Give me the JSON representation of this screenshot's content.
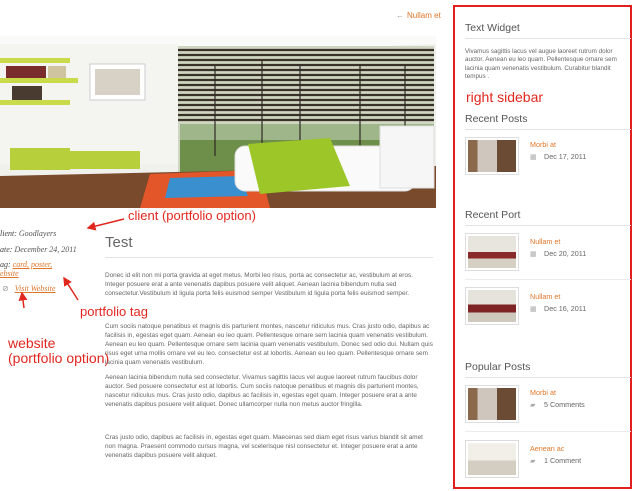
{
  "nav": {
    "next_label": "Nullam et",
    "arrow": "←"
  },
  "meta": {
    "client_label": "lient:",
    "client_value": "Goodlayers",
    "date_label": "ate:",
    "date_value": "December 24, 2011",
    "tag_label": "ag:",
    "tag_values": "card, poster,",
    "tag_cont": "ebsite",
    "website_link": "Visit Website"
  },
  "annotations": {
    "client": "client (portfolio option)",
    "tag": "portfolio tag",
    "website_line1": "website",
    "website_line2": "(portfolio option)",
    "sidebar": "right sidebar"
  },
  "article": {
    "title": "Test",
    "paragraphs": [
      "Donec id elit non mi porta gravida at eget metus. Morbi leo risus, porta ac consectetur ac, vestibulum at eros. Integer posuere erat a ante venenatis dapibus posuere velit aliquet. Aenean lacinia bibendum nulla sed consectetur.Vestibulum id ligula porta felis euismod semper Vestibulum id ligula porta felis euismod semper.",
      "Cum sociis natoque penatibus et magnis dis parturient montes, nascetur ridiculus mus. Cras justo odio, dapibus ac facilisis in, egestas eget quam. Aenean eu leo quam. Pellentesque ornare sem lacinia quam venenatis vestibulum. Aenean eu leo quam. Pellentesque ornare sem lacinia quam venenatis vestibulum. Donec sed odio dui. Nullam quis risus eget urna mollis ornare vel eu leo. consectetur est at lobortis. Aenean eu leo quam. Pellentesque ornare sem lacinia quam venenatis vestibulum.",
      "Aenean lacinia bibendum nulla sed consectetur. Vivamus sagittis lacus vel augue laoreet rutrum faucibus dolor auctor. Sed posuere consectetur est at lobortis. Cum sociis natoque penatibus et magnis dis parturient montes, nascetur ridiculus mus. Cras justo odio, dapibus ac facilisis in, egestas eget quam. Integer posuere erat a ante venenatis dapibus posuere velit aliquet. Donec ullamcorper nulla non metus auctor fringilla.",
      "Cras justo odio, dapibus ac facilisis in, egestas eget quam. Maecenas sed diam eget risus varius blandit sit amet non magna. Praesent commodo cursus magna, vel scelerisque nisl consectetur et. Integer posuere erat a ante venenatis dapibus posuere velit aliquet."
    ]
  },
  "sidebar": {
    "text_widget": {
      "title": "Text Widget",
      "body": "Vivamus sagittis lacus vel augue laoreet rutrum dolor auctor. Aenean eu leo quam. Pellentesque ornare sem lacinia quam venenatis vestibulum. Curabitur blandit tempus ."
    },
    "recent_posts": {
      "title": "Recent Posts",
      "items": [
        {
          "title": "Morbi at",
          "date": "Dec 17, 2011"
        }
      ]
    },
    "recent_port": {
      "title": "Recent Port",
      "items": [
        {
          "title": "Nullam et",
          "date": "Dec 20, 2011"
        },
        {
          "title": "Nullam et",
          "date": "Dec 16, 2011"
        }
      ]
    },
    "popular_posts": {
      "title": "Popular Posts",
      "items": [
        {
          "title": "Morbi at",
          "comments": "5 Comments"
        },
        {
          "title": "Aenean ac",
          "comments": "1 Comment"
        }
      ]
    }
  },
  "colors": {
    "accent": "#e0762a",
    "annotation": "#e2271f",
    "text": "#666666"
  },
  "icons": [
    "arrow-left-icon",
    "link-icon",
    "calendar-icon",
    "comment-icon"
  ]
}
